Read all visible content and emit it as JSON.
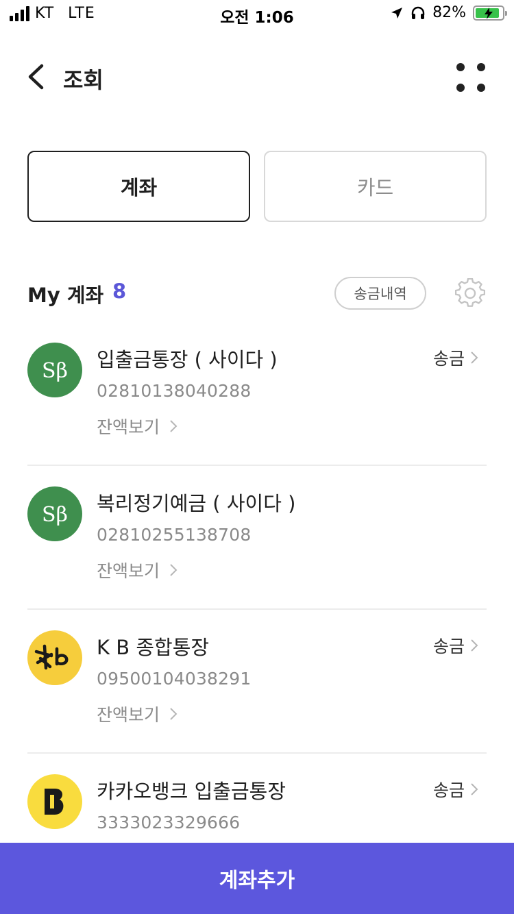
{
  "status_bar": {
    "carrier": "KT",
    "network": "LTE",
    "time": "오전 1:06",
    "battery_percent": "82%",
    "battery_level": 0.82,
    "icons": [
      "signal-icon",
      "location-arrow-icon",
      "headphones-icon",
      "battery-charging-icon"
    ]
  },
  "header": {
    "title": "조회",
    "back_icon": "chevron-left-icon",
    "menu_icon": "four-dots-icon"
  },
  "tabs": [
    {
      "label": "계좌",
      "selected": true
    },
    {
      "label": "카드",
      "selected": false
    }
  ],
  "section": {
    "title": "My 계좌",
    "count": "8",
    "history_button": "송금내역",
    "settings_icon": "gear-icon",
    "accent_color": "#5b57d8"
  },
  "accounts": [
    {
      "name": "입출금통장 ( 사이다 )",
      "number": "02810138040288",
      "balance_label": "잔액보기",
      "transfer_label": "송금",
      "bank_logo": "sb-logo",
      "logo_color": "#3f8f4e"
    },
    {
      "name": "복리정기예금 ( 사이다 )",
      "number": "02810255138708",
      "balance_label": "잔액보기",
      "transfer_label": "",
      "bank_logo": "sb-logo",
      "logo_color": "#3f8f4e"
    },
    {
      "name": "K B 종합통장",
      "number": "09500104038291",
      "balance_label": "잔액보기",
      "transfer_label": "송금",
      "bank_logo": "kb-logo",
      "logo_color": "#f6cd3c"
    },
    {
      "name": "카카오뱅크 입출금통장",
      "number": "3333023329666",
      "balance_label": "",
      "transfer_label": "송금",
      "bank_logo": "kakaobank-logo",
      "logo_color": "#f9dc3e"
    }
  ],
  "bottom_button": {
    "label": "계좌추가",
    "color": "#5c57dd"
  }
}
